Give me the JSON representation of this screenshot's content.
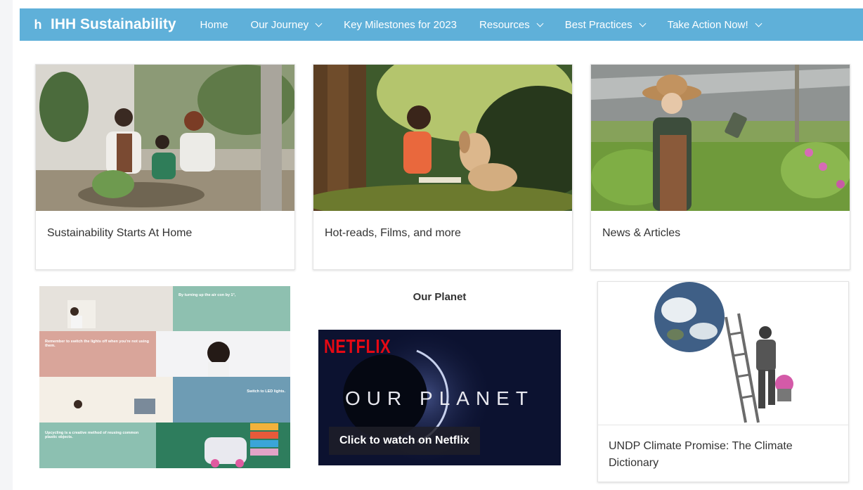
{
  "nav": {
    "logo_glyph": "h",
    "brand": "IHH Sustainability",
    "items": [
      {
        "label": "Home",
        "dropdown": false
      },
      {
        "label": "Our Journey",
        "dropdown": true
      },
      {
        "label": "Key Milestones for 2023",
        "dropdown": false
      },
      {
        "label": "Resources",
        "dropdown": true
      },
      {
        "label": "Best Practices",
        "dropdown": true
      },
      {
        "label": "Take Action Now!",
        "dropdown": true
      }
    ]
  },
  "cards": [
    {
      "label": "Sustainability Starts At Home"
    },
    {
      "label": "Hot-reads, Films, and more"
    },
    {
      "label": "News & Articles"
    }
  ],
  "tips": {
    "t1": "By turning up the air con by 1°,",
    "t2": "Remember to switch the lights off when you're not using them.",
    "t3": "Switch to LED lights.",
    "t4": "Upcycling is a creative method of reusing common plastic objects."
  },
  "our_planet": {
    "title": "Our Planet",
    "netflix_logo": "NETFLIX",
    "show_name": "OUR PLANET",
    "button": "Click to watch on Netflix"
  },
  "undp": {
    "label": "UNDP Climate Promise: The Climate Dictionary"
  },
  "colors": {
    "nav_bg": "#5fb0d9",
    "netflix_red": "#e50914"
  }
}
